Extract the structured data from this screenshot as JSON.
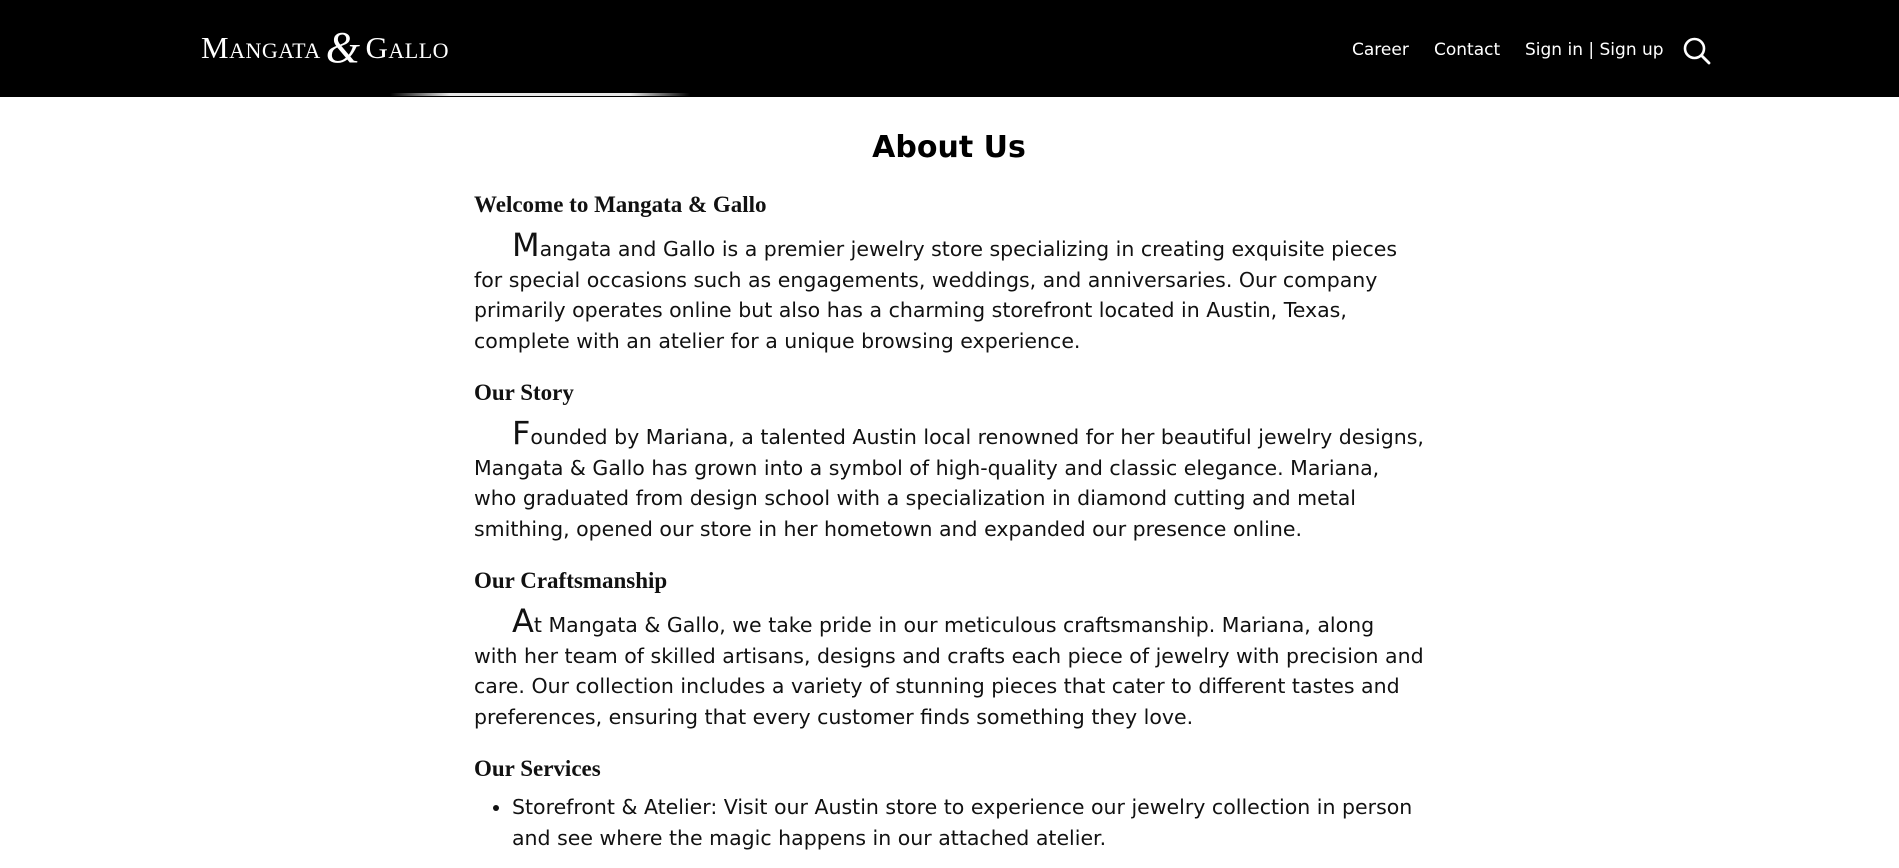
{
  "header": {
    "logo": {
      "word1": "Mangata",
      "amp": "&",
      "word2": "Gallo"
    },
    "nav": [
      {
        "label": "Career"
      },
      {
        "label": "Contact"
      },
      {
        "label": "Sign in | Sign up"
      }
    ],
    "search_icon": "search-icon"
  },
  "main": {
    "title": "About Us",
    "sections": [
      {
        "heading": "Welcome to Mangata & Gallo",
        "dropcap": "M",
        "text": "angata and Gallo is a premier jewelry store specializing in creating exquisite pieces for special occasions such as engagements, weddings, and anniversaries. Our company primarily operates online but also has a charming storefront located in Austin, Texas, complete with an atelier for a unique browsing experience."
      },
      {
        "heading": "Our Story",
        "dropcap": "F",
        "text": "ounded by Mariana, a talented Austin local renowned for her beautiful jewelry designs, Mangata & Gallo has grown into a symbol of high-quality and classic elegance. Mariana, who graduated from design school with a specialization in diamond cutting and metal smithing, opened our store in her hometown and expanded our presence online."
      },
      {
        "heading": "Our Craftsmanship",
        "dropcap": "A",
        "text": "t Mangata & Gallo, we take pride in our meticulous craftsmanship. Mariana, along with her team of skilled artisans, designs and crafts each piece of jewelry with precision and care. Our collection includes a variety of stunning pieces that cater to different tastes and preferences, ensuring that every customer finds something they love."
      }
    ],
    "services": {
      "heading": "Our Services",
      "items": [
        "Storefront & Atelier: Visit our Austin store to experience our jewelry collection in person and see where the magic happens in our attached atelier."
      ]
    }
  },
  "colors": {
    "header_bg": "#000000",
    "header_text": "#ffffff",
    "body_text": "#111111"
  }
}
